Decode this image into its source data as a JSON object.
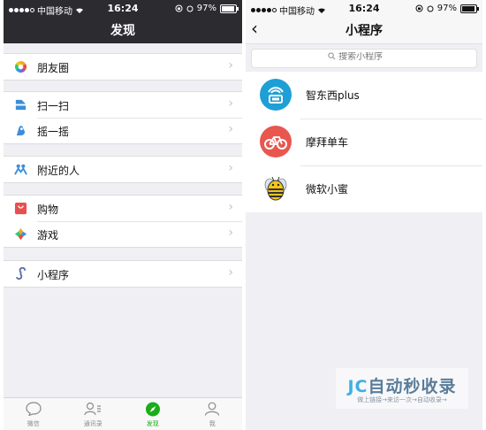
{
  "left": {
    "status": {
      "carrier": "中国移动",
      "time": "16:24",
      "battery": "97%"
    },
    "header": {
      "title": "发现"
    },
    "groups": [
      [
        {
          "label": "朋友圈",
          "icon": "moments-icon"
        }
      ],
      [
        {
          "label": "扫一扫",
          "icon": "scan-icon"
        },
        {
          "label": "摇一摇",
          "icon": "shake-icon"
        }
      ],
      [
        {
          "label": "附近的人",
          "icon": "people-nearby-icon"
        }
      ],
      [
        {
          "label": "购物",
          "icon": "shopping-icon"
        },
        {
          "label": "游戏",
          "icon": "games-icon"
        }
      ],
      [
        {
          "label": "小程序",
          "icon": "mini-program-icon"
        }
      ]
    ],
    "tabbar": [
      {
        "label": "微信",
        "icon": "chat-bubble-icon",
        "active": false
      },
      {
        "label": "通讯录",
        "icon": "contacts-icon",
        "active": false
      },
      {
        "label": "发现",
        "icon": "compass-icon",
        "active": true
      },
      {
        "label": "我",
        "icon": "person-icon",
        "active": false
      }
    ]
  },
  "right": {
    "status": {
      "carrier": "中国移动",
      "time": "16:24",
      "battery": "97%"
    },
    "header": {
      "title": "小程序",
      "back_icon": "chevron-left-icon"
    },
    "search": {
      "placeholder": "搜索小程序"
    },
    "items": [
      {
        "name": "智东西plus",
        "icon": "zhidongxi-logo-icon"
      },
      {
        "name": "摩拜单车",
        "icon": "bike-logo-icon"
      },
      {
        "name": "微软小蜜",
        "icon": "bee-logo-icon"
      }
    ]
  },
  "watermark": {
    "main": "自动秒收录",
    "brand": "JC",
    "sub": "做上链接→来访一次→自动收录→"
  },
  "colors": {
    "wechat_green": "#1aad19",
    "header_dark": "#2b2b30",
    "bg": "#efeff4"
  }
}
